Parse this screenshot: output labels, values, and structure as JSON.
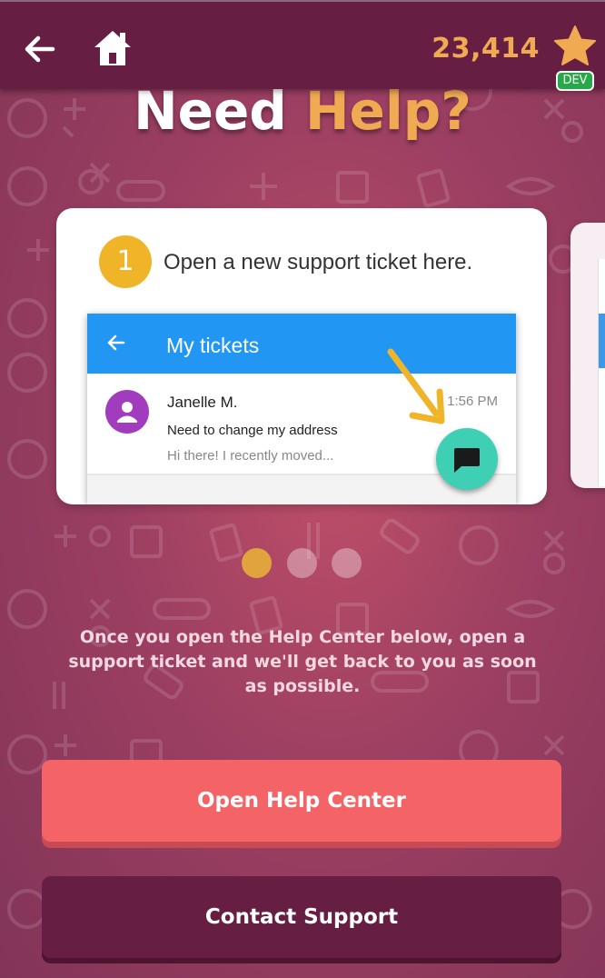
{
  "header": {
    "back_icon": "arrow-left-icon",
    "home_icon": "home-icon",
    "coins": "23,414",
    "star_icon": "star-icon",
    "badge": "DEV",
    "coin_color": "#efaa52"
  },
  "title": {
    "part1": "Need",
    "part2": "Help?"
  },
  "carousel": {
    "step_number": "1",
    "step_text": "Open a new support ticket here.",
    "mockup": {
      "bar_title": "My tickets",
      "ticket_name": "Janelle M.",
      "ticket_time": "1:56 PM",
      "ticket_subject": "Need to change my address",
      "ticket_preview": "Hi there! I recently moved...",
      "fab_icon": "chat-icon",
      "bar_color": "#2196f3",
      "fab_color": "#3fcfb5"
    },
    "page_count": 3,
    "active_page": 1
  },
  "info": {
    "text": "Once you open the Help Center below, open a support ticket and we'll get back to you as soon as possible."
  },
  "buttons": {
    "help_center": "Open Help Center",
    "contact_support": "Contact Support"
  }
}
